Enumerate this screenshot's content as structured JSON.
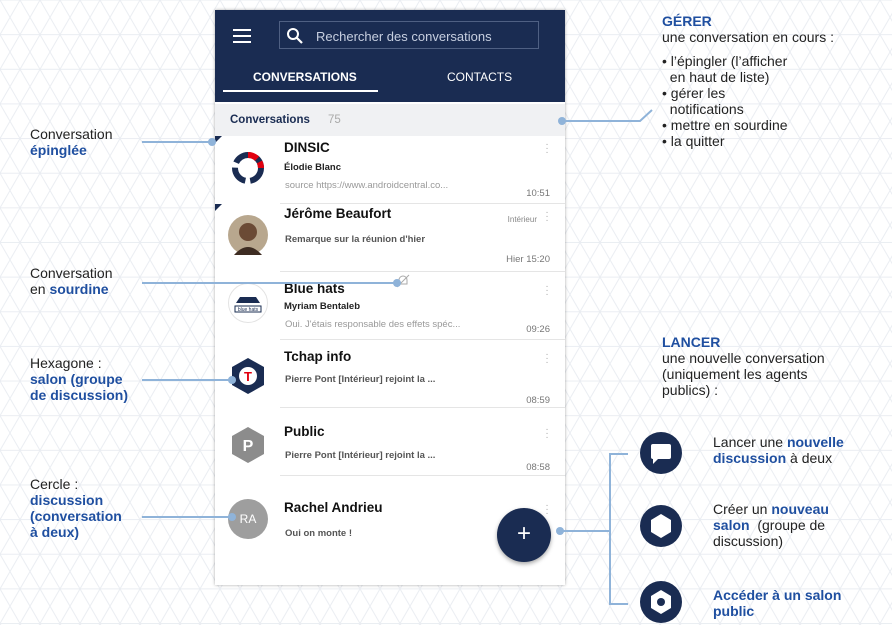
{
  "search": {
    "placeholder": "Rechercher des conversations"
  },
  "tabs": {
    "conversations": "CONVERSATIONS",
    "contacts": "CONTACTS"
  },
  "section": {
    "title": "Conversations",
    "count": "75"
  },
  "conversations": [
    {
      "name": "DINSIC",
      "sender": "Élodie Blanc",
      "preview": "source https://www.androidcentral.co...",
      "time": "10:51",
      "avatar": "dinsic-logo-icon",
      "pinned": true
    },
    {
      "name": "Jérôme Beaufort",
      "tag": "Intérieur",
      "preview": "Remarque sur la réunion d'hier",
      "time": "Hier 15:20",
      "avatar": "person-photo-avatar",
      "pinned": true
    },
    {
      "name": "Blue hats",
      "sender": "Myriam Bentaleb",
      "preview": "Oui. J'étais responsable des effets spéc...",
      "time": "09:26",
      "avatar": "blue-hats-logo-icon",
      "muted": true
    },
    {
      "name": "Tchap info",
      "preview": "Pierre Pont  [Intérieur] rejoint la ...",
      "time": "08:59",
      "avatar": "hexagon-t-icon"
    },
    {
      "name": "Public",
      "preview": "Pierre Pont  [Intérieur] rejoint la ...",
      "time": "08:58",
      "avatar": "hexagon-p-icon"
    },
    {
      "name": "Rachel Andrieu",
      "preview": "Oui on monte !",
      "avatar_initials": "RA",
      "avatar": "circle-initials-avatar"
    }
  ],
  "fab": {
    "label": "+"
  },
  "annotations": {
    "pinned": {
      "line1": "Conversation",
      "line2": "épinglée"
    },
    "muted": {
      "line1": "Conversation",
      "line2a": "en ",
      "line2b": "sourdine"
    },
    "hexagon": {
      "line1": "Hexagone :",
      "line2": "salon (groupe",
      "line3": "de discussion)"
    },
    "circle": {
      "line1": "Cercle :",
      "line2": "discussion",
      "line3": "(conversation",
      "line4": "à deux)"
    },
    "manage": {
      "title": "GÉRER",
      "subtitle": "une  conversation en cours :",
      "items": [
        "• l’épingler (l’afficher",
        "  en haut de liste)",
        "• gérer les",
        "  notifications",
        "• mettre en sourdine",
        "• la quitter"
      ]
    },
    "launch": {
      "title": "LANCER",
      "lines": [
        "une nouvelle conversation",
        "(uniquement les agents",
        "publics)  :"
      ]
    },
    "actions": {
      "new_discussion": {
        "a": "Lancer une ",
        "b": "nouvelle",
        "c": "discussion",
        "d": " à deux"
      },
      "new_room": {
        "a": "Créer un ",
        "b": "nouveau",
        "c": "salon",
        "d": "  (groupe de",
        "e": "discussion)"
      },
      "public_room": {
        "a": "Accéder à un salon",
        "b": "public"
      }
    }
  },
  "colors": {
    "navy": "#1a2c52",
    "accent_blue": "#1f4fa0",
    "connector": "#8fb3d9",
    "dinsic_red": "#e1000f"
  }
}
